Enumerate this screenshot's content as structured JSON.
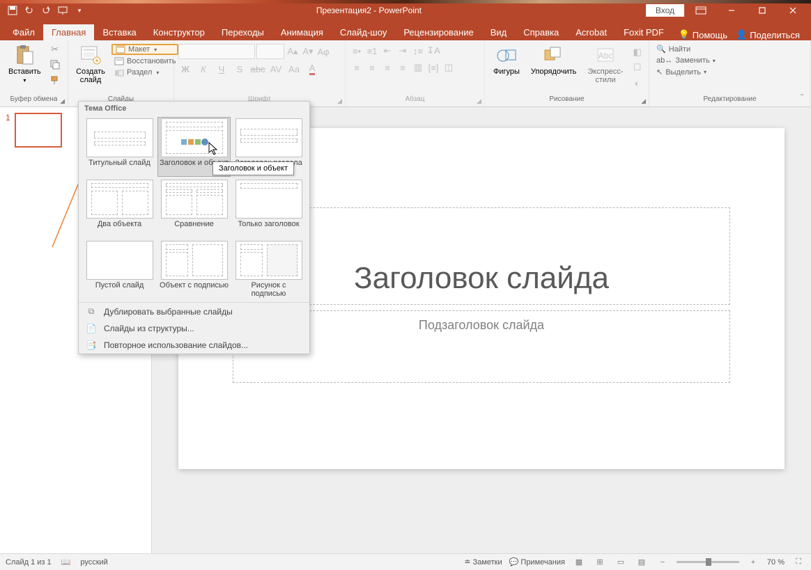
{
  "title": "Презентация2  -  PowerPoint",
  "login": "Вход",
  "tabs": {
    "file": "Файл",
    "home": "Главная",
    "insert": "Вставка",
    "design": "Конструктор",
    "transitions": "Переходы",
    "animation": "Анимация",
    "slideshow": "Слайд-шоу",
    "review": "Рецензирование",
    "view": "Вид",
    "help": "Справка",
    "acrobat": "Acrobat",
    "foxit": "Foxit PDF",
    "tellme": "Помощь",
    "share": "Поделиться"
  },
  "ribbon": {
    "clipboard": {
      "paste": "Вставить",
      "label": "Буфер обмена"
    },
    "slides": {
      "new_slide": "Создать\nслайд",
      "layout": "Макет",
      "reset": "Восстановить",
      "section": "Раздел",
      "label": "Слайды"
    },
    "font": {
      "label": "Шрифт"
    },
    "paragraph": {
      "label": "Абзац"
    },
    "drawing": {
      "shapes": "Фигуры",
      "arrange": "Упорядочить",
      "quickstyles": "Экспресс-\nстили",
      "label": "Рисование"
    },
    "editing": {
      "find": "Найти",
      "replace": "Заменить",
      "select": "Выделить",
      "label": "Редактирование"
    }
  },
  "layout_dropdown": {
    "header": "Тема Office",
    "items": [
      "Титульный слайд",
      "Заголовок и объект",
      "Заголовок раздела",
      "Два объекта",
      "Сравнение",
      "Только заголовок",
      "Пустой слайд",
      "Объект с подписью",
      "Рисунок с подписью"
    ],
    "tooltip": "Заголовок и объект",
    "menu": [
      "Дублировать выбранные слайды",
      "Слайды из структуры...",
      "Повторное использование слайдов..."
    ]
  },
  "slide": {
    "title": "Заголовок слайда",
    "subtitle": "Подзаголовок слайда"
  },
  "status": {
    "slide_info": "Слайд 1 из 1",
    "language": "русский",
    "notes": "Заметки",
    "comments": "Примечания",
    "zoom": "70 %"
  },
  "slide_number": "1"
}
